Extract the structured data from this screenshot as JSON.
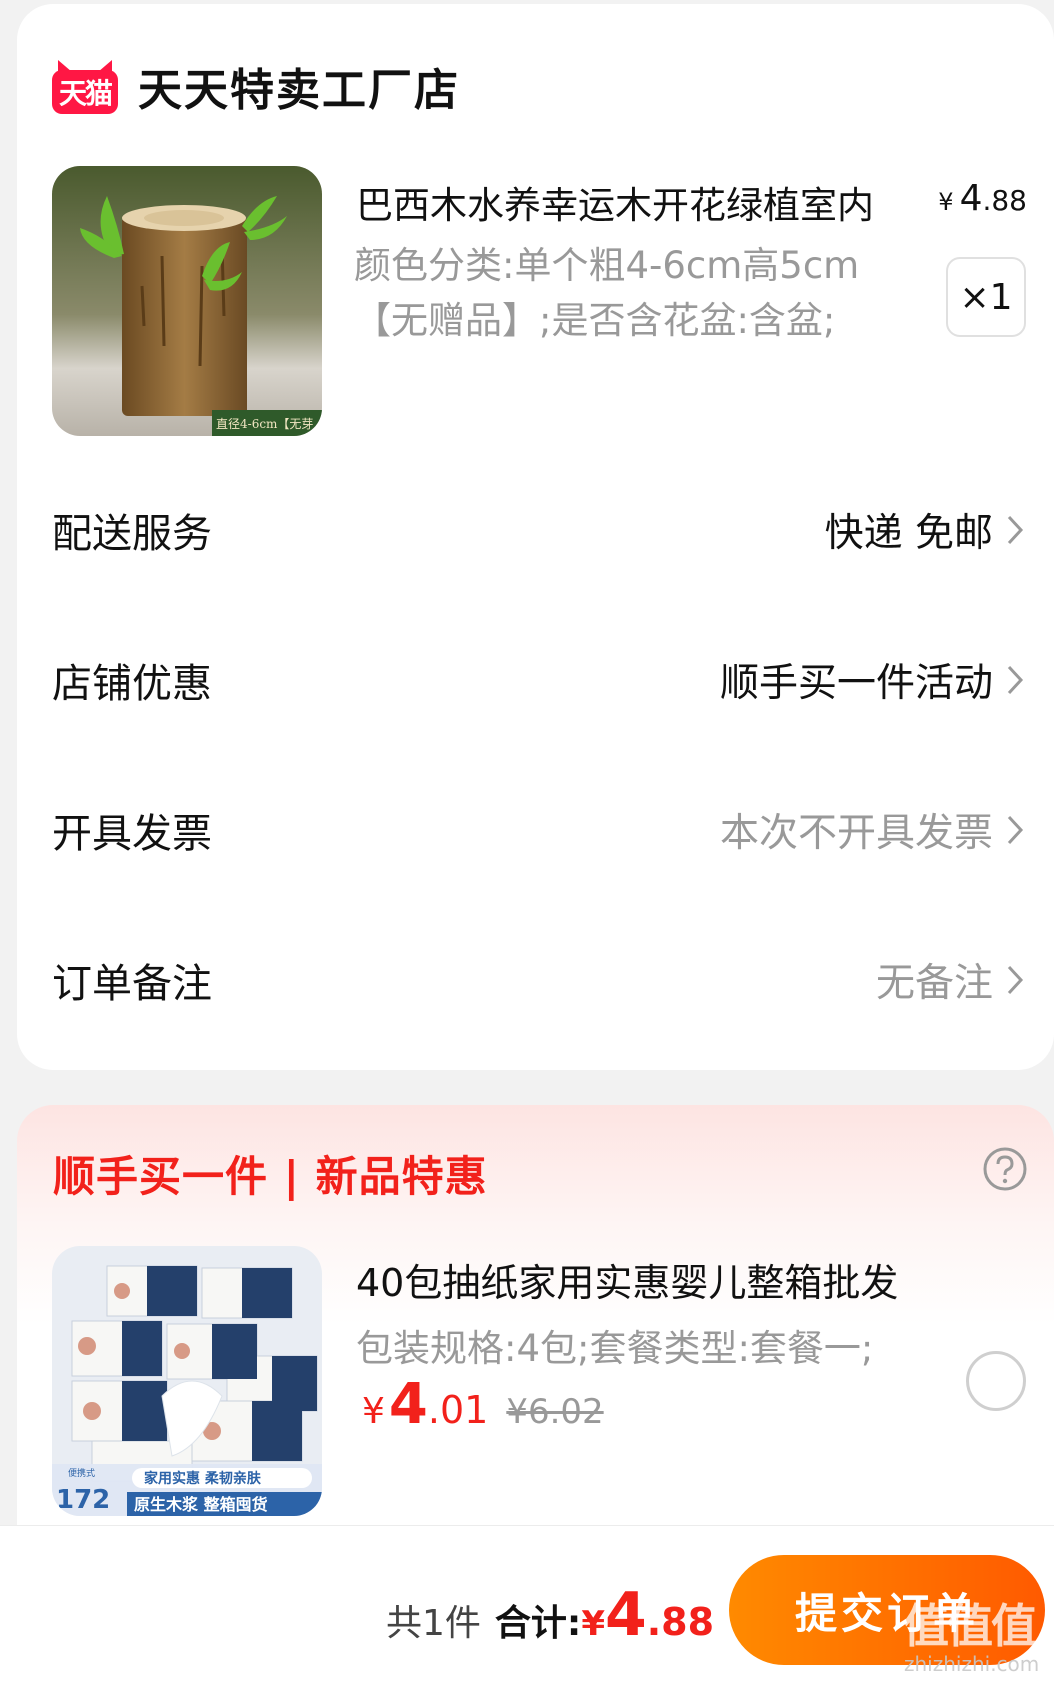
{
  "shop": {
    "badge": "天猫",
    "name": "天天特卖工厂店"
  },
  "product": {
    "title": "巴西木水养幸运木开花绿植室内",
    "price_symbol": "¥",
    "price_int": "4",
    "price_dec": ".88",
    "spec": "颜色分类:单个粗4-6cm高5cm【无赠品】;是否含花盆:含盆;",
    "quantity": "×1",
    "image_caption": "直径4-6cm【无芽"
  },
  "rows": {
    "delivery": {
      "label": "配送服务",
      "value": "快递 免邮"
    },
    "shop_discount": {
      "label": "店铺优惠",
      "value": "顺手买一件活动"
    },
    "invoice": {
      "label": "开具发票",
      "value": "本次不开具发票"
    },
    "note": {
      "label": "订单备注",
      "value": "无备注"
    }
  },
  "promo": {
    "title": "顺手买一件 | 新品特惠",
    "product": {
      "title": "40包抽纸家用实惠婴儿整箱批发",
      "spec": "包装规格:4包;套餐类型:套餐一;",
      "price_symbol": "¥",
      "price_int": "4",
      "price_dec": ".01",
      "original_price": "¥6.02",
      "image_banner_top": "家用实惠 柔韧亲肤",
      "image_banner_bottom": "原生木浆 整箱囤货",
      "image_count": "172",
      "image_count_label": "便携式"
    }
  },
  "footer": {
    "count": "共1件",
    "total_label": "合计:",
    "total_symbol": "¥",
    "total_int": "4",
    "total_dec": ".88",
    "submit": "提交订单"
  },
  "watermark": {
    "main": "值值值",
    "sub": "zhizhizhi.com"
  },
  "colors": {
    "accent_red": "#f2211b",
    "tmall_red": "#ff1744",
    "submit_orange": "#ff6a00"
  }
}
